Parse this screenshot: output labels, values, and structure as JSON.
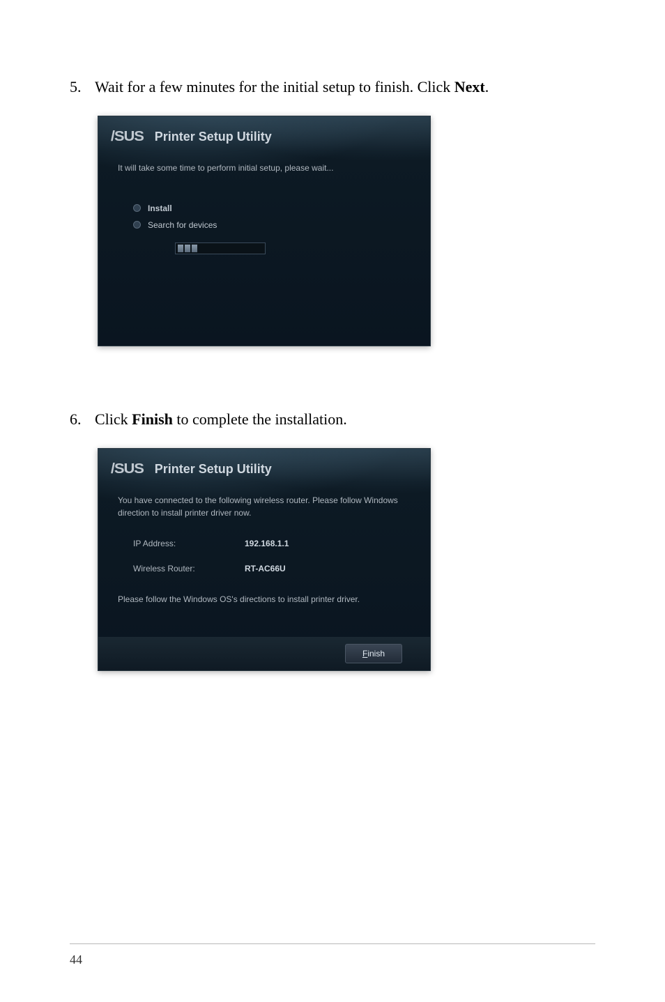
{
  "instructions": {
    "step5": {
      "number": "5.",
      "text_before": "Wait for a few minutes for the initial setup to finish. Click ",
      "bold": "Next",
      "text_after": "."
    },
    "step6": {
      "number": "6.",
      "text_before": "Click ",
      "bold": "Finish",
      "text_after": " to complete the installation."
    }
  },
  "dialog1": {
    "logo": "/SUS",
    "title": "Printer Setup Utility",
    "info": "It will take some time to perform initial setup, please wait...",
    "radio1": "Install",
    "radio2": "Search for devices"
  },
  "dialog2": {
    "logo": "/SUS",
    "title": "Printer Setup Utility",
    "info": "You have connected to the following wireless router. Please follow Windows direction to install printer driver now.",
    "ip_label": "IP Address:",
    "ip_value": "192.168.1.1",
    "router_label": "Wireless Router:",
    "router_value": "RT-AC66U",
    "follow": "Please follow the Windows OS's directions to install printer driver.",
    "finish_f": "F",
    "finish_rest": "inish"
  },
  "page_number": "44"
}
